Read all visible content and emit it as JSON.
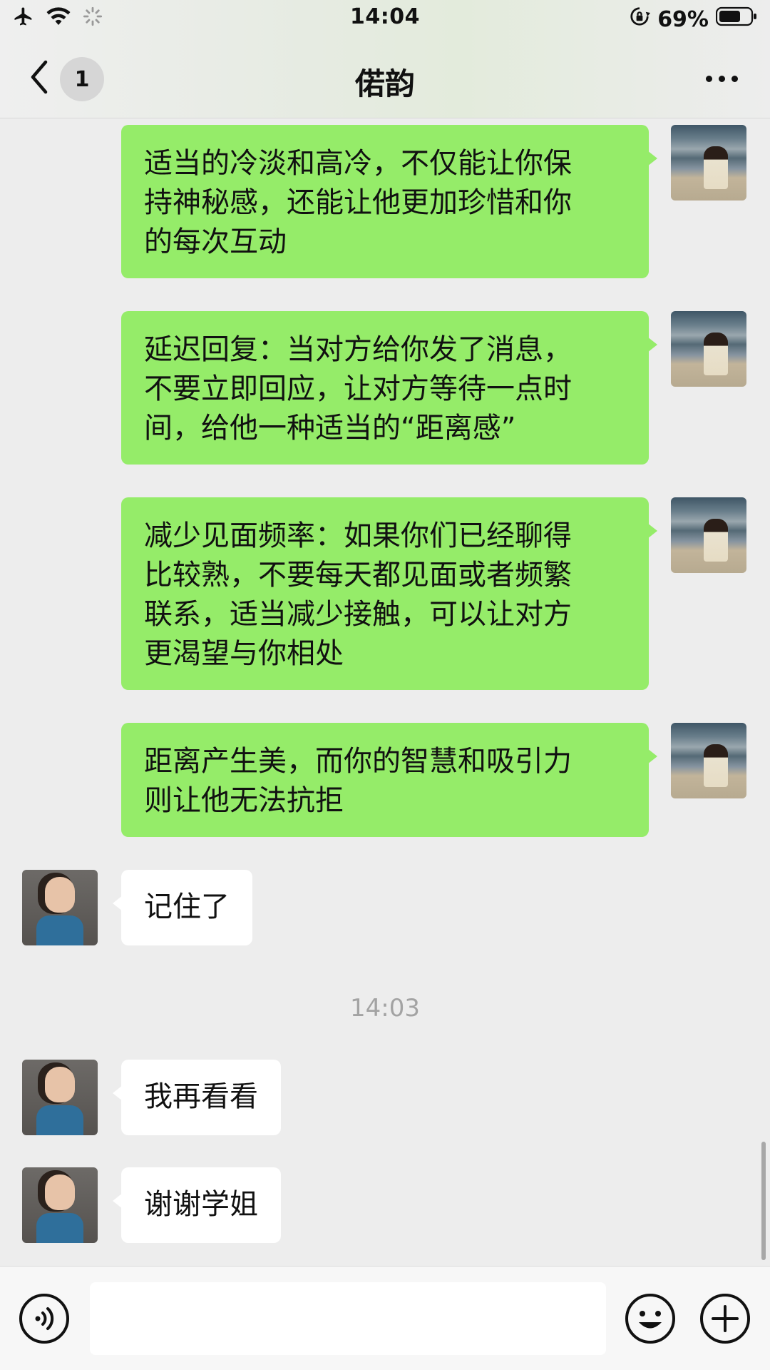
{
  "status_bar": {
    "time": "14:04",
    "battery_percent": "69%",
    "battery_level": 0.69,
    "icons": [
      "airplane-icon",
      "wifi-icon",
      "loading-icon",
      "orientation-lock-icon",
      "battery-icon"
    ]
  },
  "nav": {
    "title": "偌韵",
    "unread_count": "1",
    "icons": [
      "back-chevron-icon",
      "more-icon"
    ]
  },
  "messages": [
    {
      "from": "me",
      "text": "适当的冷淡和高冷，不仅能让你保\n持神秘感，还能让他更加珍惜和你\n的每次互动"
    },
    {
      "from": "me",
      "text": "延迟回复：当对方给你发了消息，\n不要立即回应，让对方等待一点时\n间，给他一种适当的“距离感”"
    },
    {
      "from": "me",
      "text": "减少见面频率：如果你们已经聊得\n比较熟，不要每天都见面或者频繁\n联系，适当减少接触，可以让对方\n更渴望与你相处"
    },
    {
      "from": "me",
      "text": "距离产生美，而你的智慧和吸引力\n则让他无法抗拒"
    },
    {
      "from": "them",
      "text": "记住了"
    },
    {
      "from": "them",
      "text": "我再看看"
    },
    {
      "from": "them",
      "text": "谢谢学姐"
    }
  ],
  "timestamp": "14:03",
  "input_bar": {
    "icons": [
      "voice-icon",
      "emoji-icon",
      "plus-icon"
    ],
    "value": ""
  },
  "colors": {
    "my_bubble": "#95ec69",
    "their_bubble": "#ffffff",
    "background": "#ededed"
  }
}
